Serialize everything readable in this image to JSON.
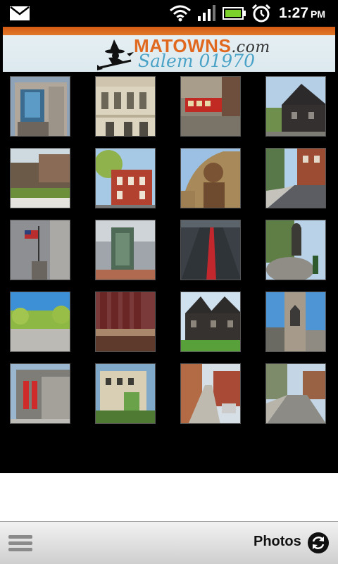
{
  "status_bar": {
    "time": "1:27",
    "ampm": "PM",
    "icons": [
      "mail-icon",
      "wifi-icon",
      "signal-icon",
      "battery-icon",
      "alarm-icon"
    ]
  },
  "header": {
    "brand": "MATOWNS",
    "brand_suffix": ".com",
    "subtitle": "Salem 01970",
    "colors": {
      "accent": "#e0681f",
      "subtitle": "#4aa3c7",
      "bar": "#d55a12"
    }
  },
  "gallery": {
    "photos": [
      {
        "name": "photo-building-glass"
      },
      {
        "name": "photo-town-hall"
      },
      {
        "name": "photo-trolley"
      },
      {
        "name": "photo-dark-house"
      },
      {
        "name": "photo-park"
      },
      {
        "name": "photo-brick-building"
      },
      {
        "name": "photo-statue"
      },
      {
        "name": "photo-street"
      },
      {
        "name": "photo-flag-building"
      },
      {
        "name": "photo-monument"
      },
      {
        "name": "photo-red-line"
      },
      {
        "name": "photo-rock-statue"
      },
      {
        "name": "photo-trees"
      },
      {
        "name": "photo-witch-museum"
      },
      {
        "name": "photo-seven-gables"
      },
      {
        "name": "photo-stone-church"
      },
      {
        "name": "photo-modern-building"
      },
      {
        "name": "photo-green-house"
      },
      {
        "name": "photo-sidewalk"
      },
      {
        "name": "photo-residential-street"
      }
    ]
  },
  "bottom_bar": {
    "label": "Photos"
  }
}
